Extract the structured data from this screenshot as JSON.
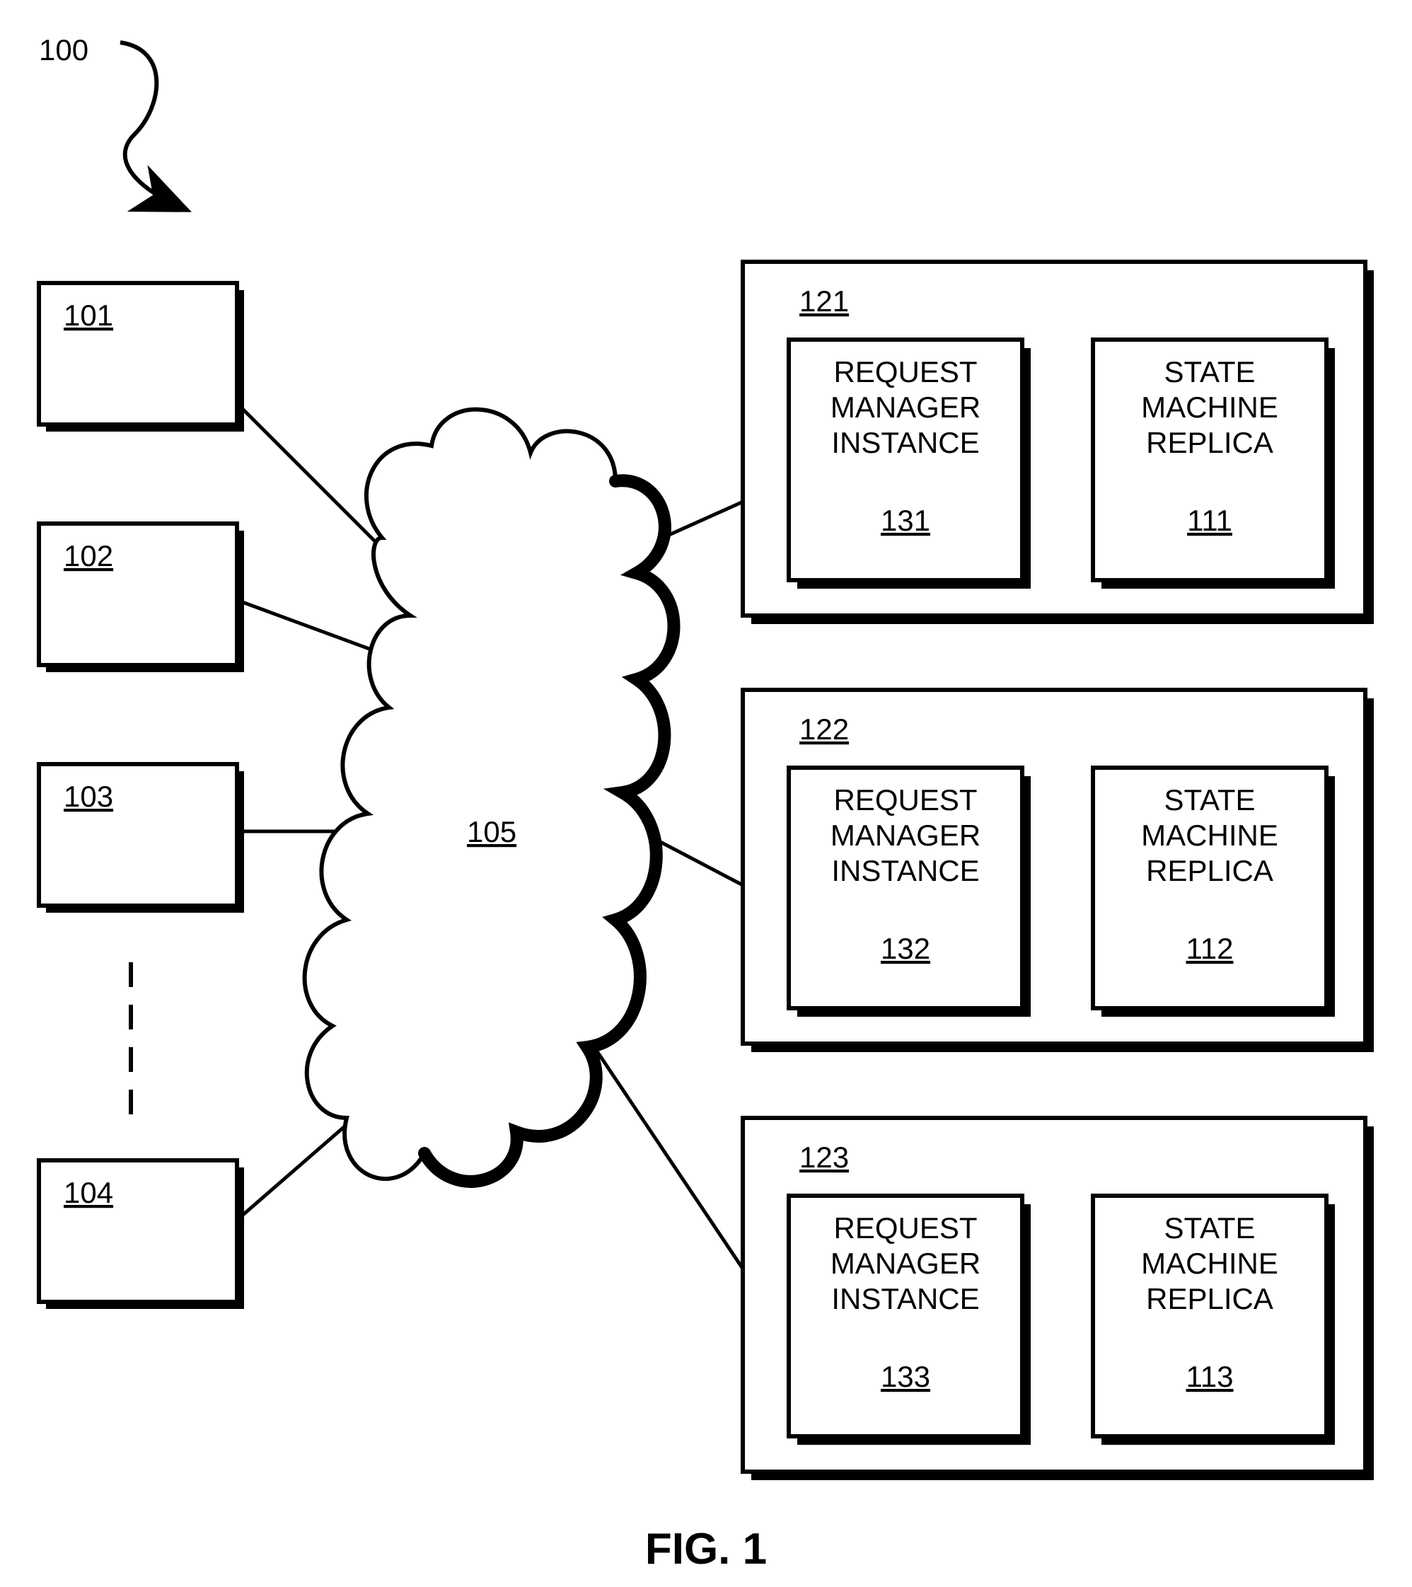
{
  "figure_ref": "100",
  "figure_label": "FIG. 1",
  "cloud_ref": "105",
  "clients": [
    {
      "ref": "101"
    },
    {
      "ref": "102"
    },
    {
      "ref": "103"
    },
    {
      "ref": "104"
    }
  ],
  "servers": [
    {
      "ref": "121",
      "rmi_label_l1": "REQUEST",
      "rmi_label_l2": "MANAGER",
      "rmi_label_l3": "INSTANCE",
      "rmi_ref": "131",
      "smr_label_l1": "STATE",
      "smr_label_l2": "MACHINE",
      "smr_label_l3": "REPLICA",
      "smr_ref": "111"
    },
    {
      "ref": "122",
      "rmi_label_l1": "REQUEST",
      "rmi_label_l2": "MANAGER",
      "rmi_label_l3": "INSTANCE",
      "rmi_ref": "132",
      "smr_label_l1": "STATE",
      "smr_label_l2": "MACHINE",
      "smr_label_l3": "REPLICA",
      "smr_ref": "112"
    },
    {
      "ref": "123",
      "rmi_label_l1": "REQUEST",
      "rmi_label_l2": "MANAGER",
      "rmi_label_l3": "INSTANCE",
      "rmi_ref": "133",
      "smr_label_l1": "STATE",
      "smr_label_l2": "MACHINE",
      "smr_label_l3": "REPLICA",
      "smr_ref": "113"
    }
  ]
}
